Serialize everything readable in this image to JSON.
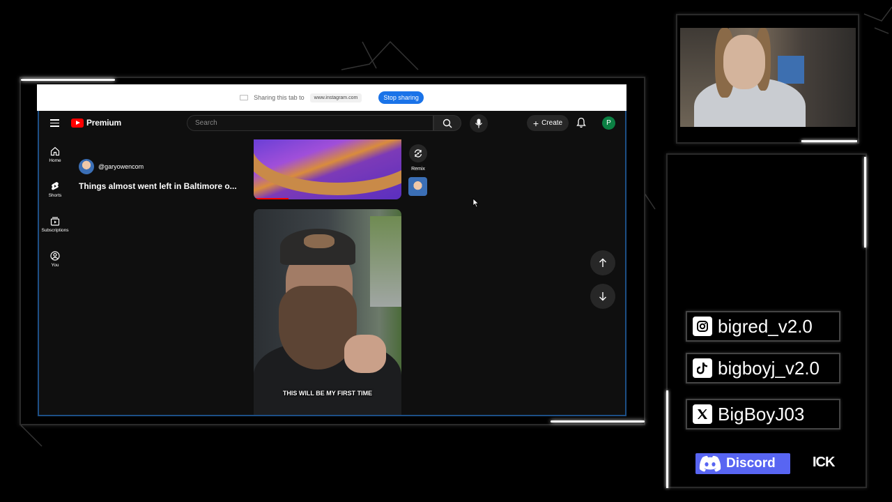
{
  "share_bar": {
    "text": "Sharing this tab to",
    "url": "www.instagram.com",
    "stop_label": "Stop sharing"
  },
  "youtube": {
    "logo_text": "Premium",
    "search_placeholder": "Search",
    "create_label": "Create",
    "avatar_letter": "P",
    "sidebar": [
      {
        "label": "Home",
        "icon": "home-icon"
      },
      {
        "label": "Shorts",
        "icon": "shorts-icon"
      },
      {
        "label": "Subscriptions",
        "icon": "subscriptions-icon"
      },
      {
        "label": "You",
        "icon": "you-icon"
      }
    ],
    "short": {
      "channel": "@garyowencom",
      "title": "Things almost went left in Baltimore o...",
      "remix_label": "Remix",
      "caption": "THIS WILL BE MY FIRST TIME"
    }
  },
  "socials": [
    {
      "platform": "instagram-icon",
      "handle": "bigred_v2.0"
    },
    {
      "platform": "tiktok-icon",
      "handle": "bigboyj_v2.0"
    },
    {
      "platform": "x-icon",
      "handle": "BigBoyJ03"
    }
  ],
  "discord": {
    "label": "Discord",
    "extra": "ICK"
  },
  "colors": {
    "youtube_red": "#ff0000",
    "share_blue": "#1a73e8",
    "discord_blurple": "#5865f2",
    "frame_blue": "#1d4f86",
    "avatar_green": "#0b8043"
  }
}
